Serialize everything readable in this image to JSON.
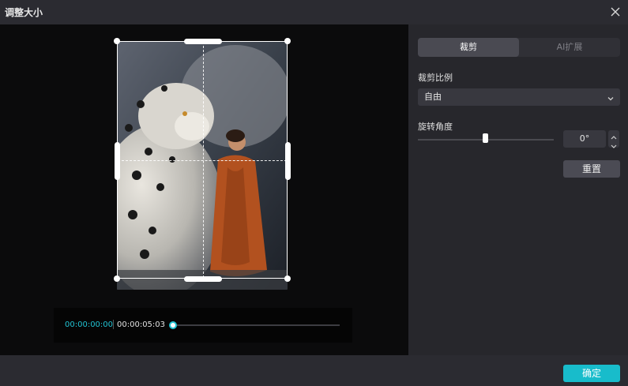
{
  "dialog": {
    "title": "调整大小"
  },
  "timeline": {
    "current": "00:00:00:00",
    "duration": "00:00:05:03"
  },
  "tabs": [
    {
      "label": "裁剪"
    },
    {
      "label": "AI扩展"
    }
  ],
  "crop_ratio": {
    "label": "裁剪比例",
    "value": "自由"
  },
  "rotation": {
    "label": "旋转角度",
    "value": "0°"
  },
  "buttons": {
    "reset": "重置",
    "confirm": "确定"
  },
  "colors": {
    "accent": "#18bccb",
    "timecode": "#21c3d3"
  }
}
